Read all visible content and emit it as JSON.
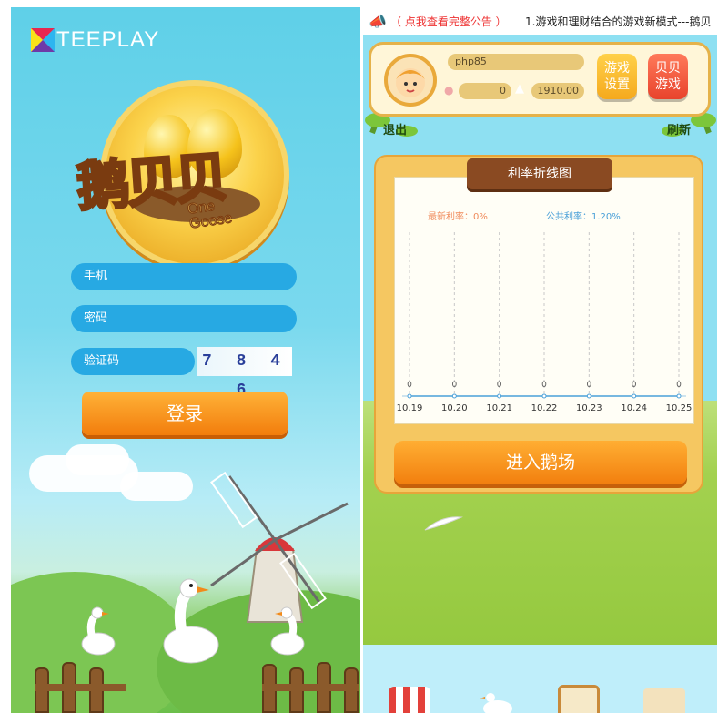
{
  "login_screen": {
    "brand": "TEEPLAY",
    "game_title": "鹅贝贝",
    "game_subtitle": "One Goose",
    "phone_placeholder": "手机",
    "password_placeholder": "密码",
    "captcha_placeholder": "验证码",
    "captcha_code": "7 8 4 6",
    "login_label": "登录"
  },
  "game_screen": {
    "announcement": {
      "notice_link": "（ 点我查看完整公告 ）",
      "marquee_text": "1.游戏和理财结合的游戏新模式---鹅贝"
    },
    "user": {
      "username": "php85",
      "eggs": "0",
      "coins": "1910.00"
    },
    "buttons": {
      "game_settings": "游戏设置",
      "beibei_game": "贝贝游戏",
      "logout": "退出",
      "refresh": "刷新",
      "enter_farm": "进入鹅场"
    },
    "chart_title": "利率折线图"
  },
  "chart_data": {
    "type": "line",
    "title": "利率折线图",
    "annotations": [
      "最新利率：0%",
      "公共利率：1.20%"
    ],
    "categories": [
      "10.19",
      "10.20",
      "10.21",
      "10.22",
      "10.23",
      "10.24",
      "10.25"
    ],
    "values": [
      0,
      0,
      0,
      0,
      0,
      0,
      0
    ],
    "grid": true
  },
  "colors": {
    "accent_orange": "#f27d0c",
    "field_blue": "#27a9e3",
    "latest_rate": "#f08a5a",
    "public_rate": "#4aa0d8"
  }
}
